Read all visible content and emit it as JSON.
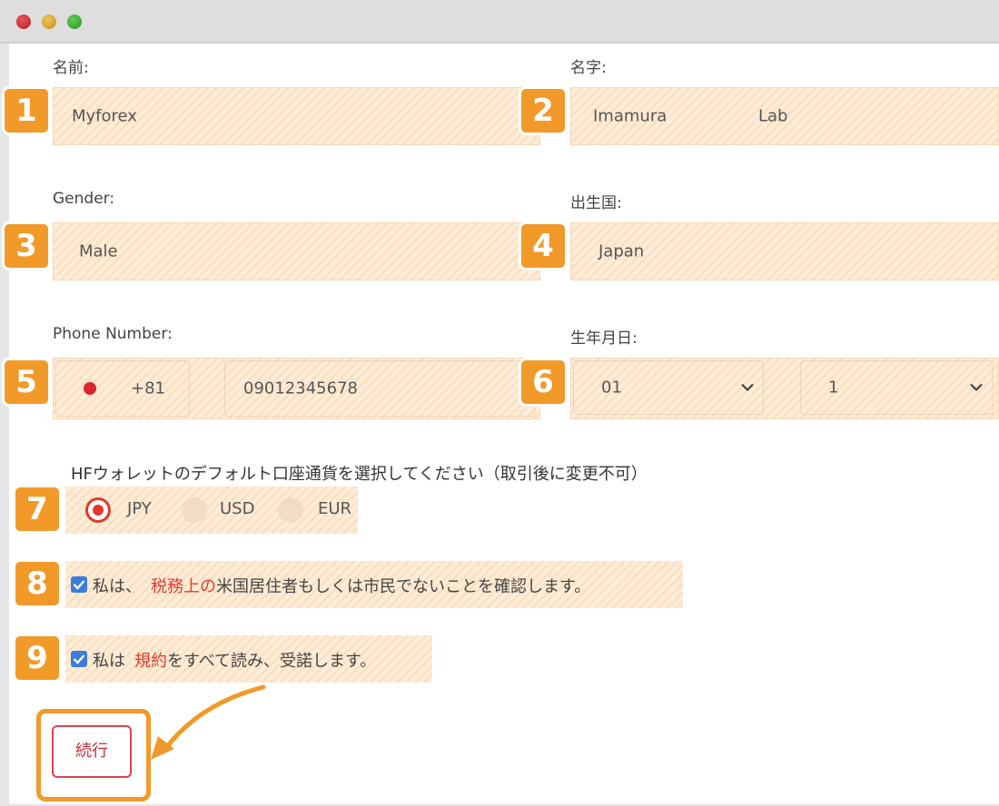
{
  "window": {
    "controls": [
      "close",
      "minimize",
      "maximize"
    ]
  },
  "form": {
    "first_name_label": "名前:",
    "first_name_value": "Myforex",
    "last_name_label": "名字:",
    "last_name_value": "Imamura",
    "last_name_extra": "Lab",
    "gender_label": "Gender:",
    "gender_value": "Male",
    "country_label": "出生国:",
    "country_value": "Japan",
    "phone_label": "Phone Number:",
    "phone_code": "+81",
    "phone_value": "09012345678",
    "dob_label": "生年月日:",
    "dob_month": "01",
    "dob_day": "1",
    "currency_prompt": "HFウォレットのデフォルト口座通貨を選択してください（取引後に変更不可）",
    "currency_options": [
      "JPY",
      "USD",
      "EUR"
    ],
    "currency_selected": "JPY",
    "tax_check_pre": "私は、",
    "tax_check_link": "税務上の",
    "tax_check_post": "米国居住者もしくは市民でないことを確認します。",
    "tax_checked": true,
    "terms_check_pre": "私は",
    "terms_check_link": "規約",
    "terms_check_post": "をすべて読み、受諾します。",
    "terms_checked": true,
    "submit_label": "続行"
  },
  "annotations": {
    "badges": [
      "1",
      "2",
      "3",
      "4",
      "5",
      "6",
      "7",
      "8",
      "9"
    ],
    "accent_color": "#f19a2a"
  },
  "colors": {
    "link_red": "#e23a2e",
    "button_border": "#d9464f",
    "checkbox_blue": "#3b7ddd"
  }
}
